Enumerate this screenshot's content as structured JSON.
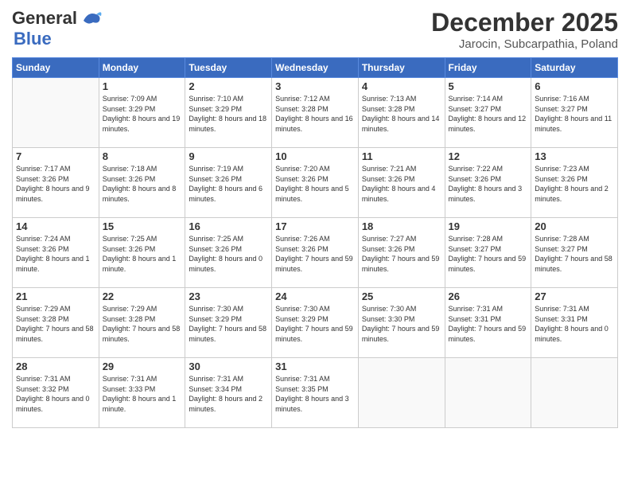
{
  "logo": {
    "line1": "General",
    "line2": "Blue"
  },
  "title": "December 2025",
  "subtitle": "Jarocin, Subcarpathia, Poland",
  "days": [
    "Sunday",
    "Monday",
    "Tuesday",
    "Wednesday",
    "Thursday",
    "Friday",
    "Saturday"
  ],
  "weeks": [
    [
      {
        "num": "",
        "sunrise": "",
        "sunset": "",
        "daylight": ""
      },
      {
        "num": "1",
        "sunrise": "Sunrise: 7:09 AM",
        "sunset": "Sunset: 3:29 PM",
        "daylight": "Daylight: 8 hours and 19 minutes."
      },
      {
        "num": "2",
        "sunrise": "Sunrise: 7:10 AM",
        "sunset": "Sunset: 3:29 PM",
        "daylight": "Daylight: 8 hours and 18 minutes."
      },
      {
        "num": "3",
        "sunrise": "Sunrise: 7:12 AM",
        "sunset": "Sunset: 3:28 PM",
        "daylight": "Daylight: 8 hours and 16 minutes."
      },
      {
        "num": "4",
        "sunrise": "Sunrise: 7:13 AM",
        "sunset": "Sunset: 3:28 PM",
        "daylight": "Daylight: 8 hours and 14 minutes."
      },
      {
        "num": "5",
        "sunrise": "Sunrise: 7:14 AM",
        "sunset": "Sunset: 3:27 PM",
        "daylight": "Daylight: 8 hours and 12 minutes."
      },
      {
        "num": "6",
        "sunrise": "Sunrise: 7:16 AM",
        "sunset": "Sunset: 3:27 PM",
        "daylight": "Daylight: 8 hours and 11 minutes."
      }
    ],
    [
      {
        "num": "7",
        "sunrise": "Sunrise: 7:17 AM",
        "sunset": "Sunset: 3:26 PM",
        "daylight": "Daylight: 8 hours and 9 minutes."
      },
      {
        "num": "8",
        "sunrise": "Sunrise: 7:18 AM",
        "sunset": "Sunset: 3:26 PM",
        "daylight": "Daylight: 8 hours and 8 minutes."
      },
      {
        "num": "9",
        "sunrise": "Sunrise: 7:19 AM",
        "sunset": "Sunset: 3:26 PM",
        "daylight": "Daylight: 8 hours and 6 minutes."
      },
      {
        "num": "10",
        "sunrise": "Sunrise: 7:20 AM",
        "sunset": "Sunset: 3:26 PM",
        "daylight": "Daylight: 8 hours and 5 minutes."
      },
      {
        "num": "11",
        "sunrise": "Sunrise: 7:21 AM",
        "sunset": "Sunset: 3:26 PM",
        "daylight": "Daylight: 8 hours and 4 minutes."
      },
      {
        "num": "12",
        "sunrise": "Sunrise: 7:22 AM",
        "sunset": "Sunset: 3:26 PM",
        "daylight": "Daylight: 8 hours and 3 minutes."
      },
      {
        "num": "13",
        "sunrise": "Sunrise: 7:23 AM",
        "sunset": "Sunset: 3:26 PM",
        "daylight": "Daylight: 8 hours and 2 minutes."
      }
    ],
    [
      {
        "num": "14",
        "sunrise": "Sunrise: 7:24 AM",
        "sunset": "Sunset: 3:26 PM",
        "daylight": "Daylight: 8 hours and 1 minute."
      },
      {
        "num": "15",
        "sunrise": "Sunrise: 7:25 AM",
        "sunset": "Sunset: 3:26 PM",
        "daylight": "Daylight: 8 hours and 1 minute."
      },
      {
        "num": "16",
        "sunrise": "Sunrise: 7:25 AM",
        "sunset": "Sunset: 3:26 PM",
        "daylight": "Daylight: 8 hours and 0 minutes."
      },
      {
        "num": "17",
        "sunrise": "Sunrise: 7:26 AM",
        "sunset": "Sunset: 3:26 PM",
        "daylight": "Daylight: 7 hours and 59 minutes."
      },
      {
        "num": "18",
        "sunrise": "Sunrise: 7:27 AM",
        "sunset": "Sunset: 3:26 PM",
        "daylight": "Daylight: 7 hours and 59 minutes."
      },
      {
        "num": "19",
        "sunrise": "Sunrise: 7:28 AM",
        "sunset": "Sunset: 3:27 PM",
        "daylight": "Daylight: 7 hours and 59 minutes."
      },
      {
        "num": "20",
        "sunrise": "Sunrise: 7:28 AM",
        "sunset": "Sunset: 3:27 PM",
        "daylight": "Daylight: 7 hours and 58 minutes."
      }
    ],
    [
      {
        "num": "21",
        "sunrise": "Sunrise: 7:29 AM",
        "sunset": "Sunset: 3:28 PM",
        "daylight": "Daylight: 7 hours and 58 minutes."
      },
      {
        "num": "22",
        "sunrise": "Sunrise: 7:29 AM",
        "sunset": "Sunset: 3:28 PM",
        "daylight": "Daylight: 7 hours and 58 minutes."
      },
      {
        "num": "23",
        "sunrise": "Sunrise: 7:30 AM",
        "sunset": "Sunset: 3:29 PM",
        "daylight": "Daylight: 7 hours and 58 minutes."
      },
      {
        "num": "24",
        "sunrise": "Sunrise: 7:30 AM",
        "sunset": "Sunset: 3:29 PM",
        "daylight": "Daylight: 7 hours and 59 minutes."
      },
      {
        "num": "25",
        "sunrise": "Sunrise: 7:30 AM",
        "sunset": "Sunset: 3:30 PM",
        "daylight": "Daylight: 7 hours and 59 minutes."
      },
      {
        "num": "26",
        "sunrise": "Sunrise: 7:31 AM",
        "sunset": "Sunset: 3:31 PM",
        "daylight": "Daylight: 7 hours and 59 minutes."
      },
      {
        "num": "27",
        "sunrise": "Sunrise: 7:31 AM",
        "sunset": "Sunset: 3:31 PM",
        "daylight": "Daylight: 8 hours and 0 minutes."
      }
    ],
    [
      {
        "num": "28",
        "sunrise": "Sunrise: 7:31 AM",
        "sunset": "Sunset: 3:32 PM",
        "daylight": "Daylight: 8 hours and 0 minutes."
      },
      {
        "num": "29",
        "sunrise": "Sunrise: 7:31 AM",
        "sunset": "Sunset: 3:33 PM",
        "daylight": "Daylight: 8 hours and 1 minute."
      },
      {
        "num": "30",
        "sunrise": "Sunrise: 7:31 AM",
        "sunset": "Sunset: 3:34 PM",
        "daylight": "Daylight: 8 hours and 2 minutes."
      },
      {
        "num": "31",
        "sunrise": "Sunrise: 7:31 AM",
        "sunset": "Sunset: 3:35 PM",
        "daylight": "Daylight: 8 hours and 3 minutes."
      },
      {
        "num": "",
        "sunrise": "",
        "sunset": "",
        "daylight": ""
      },
      {
        "num": "",
        "sunrise": "",
        "sunset": "",
        "daylight": ""
      },
      {
        "num": "",
        "sunrise": "",
        "sunset": "",
        "daylight": ""
      }
    ]
  ]
}
